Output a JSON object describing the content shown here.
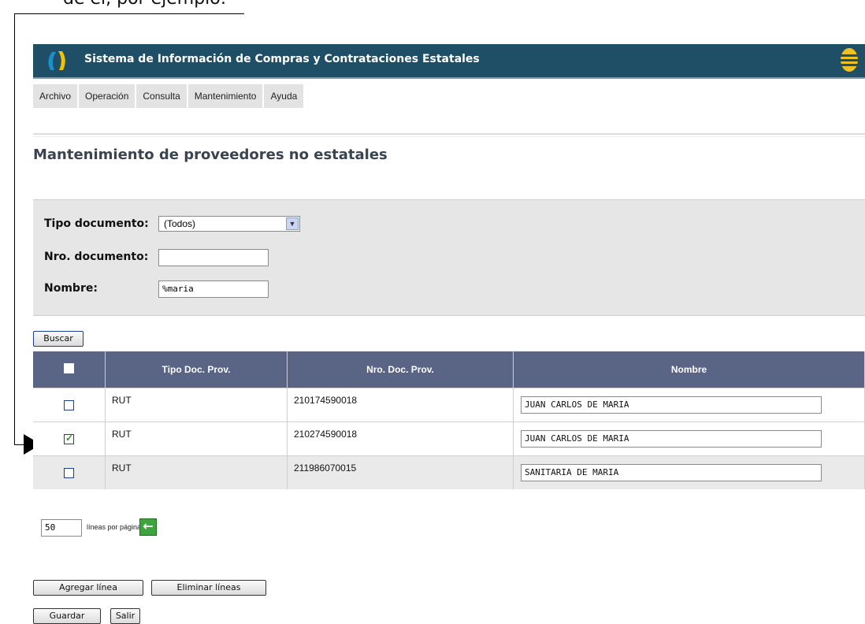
{
  "doc_caption": "de él, por ejemplo:",
  "header": {
    "title": "Sistema de Información de Compras y Contrataciones Estatales"
  },
  "menu": [
    "Archivo",
    "Operación",
    "Consulta",
    "Mantenimiento",
    "Ayuda"
  ],
  "page_title": "Mantenimiento de proveedores no estatales",
  "filters": {
    "tipo_label": "Tipo documento:",
    "tipo_value": "(Todos)",
    "nro_label": "Nro. documento:",
    "nro_value": "",
    "nombre_label": "Nombre:",
    "nombre_value": "%maria"
  },
  "search_button": "Buscar",
  "table": {
    "headers": [
      "Tipo Doc. Prov.",
      "Nro. Doc. Prov.",
      "Nombre"
    ],
    "rows": [
      {
        "checked": false,
        "tipo": "RUT",
        "nro": "210174590018",
        "nombre": "JUAN CARLOS DE MARIA"
      },
      {
        "checked": true,
        "tipo": "RUT",
        "nro": "210274590018",
        "nombre": "JUAN CARLOS DE MARIA"
      },
      {
        "checked": false,
        "tipo": "RUT",
        "nro": "211986070015",
        "nombre": "SANITARIA DE MARIA"
      }
    ]
  },
  "pagination": {
    "lines_value": "50",
    "lines_label": "líneas por página"
  },
  "actions": {
    "add": "Agregar línea",
    "delete": "Eliminar líneas",
    "save": "Guardar",
    "exit": "Salir"
  },
  "colors": {
    "header_bg": "#1f4f66",
    "table_header_bg": "#5a6585",
    "filter_bg": "#e6e6e6"
  }
}
